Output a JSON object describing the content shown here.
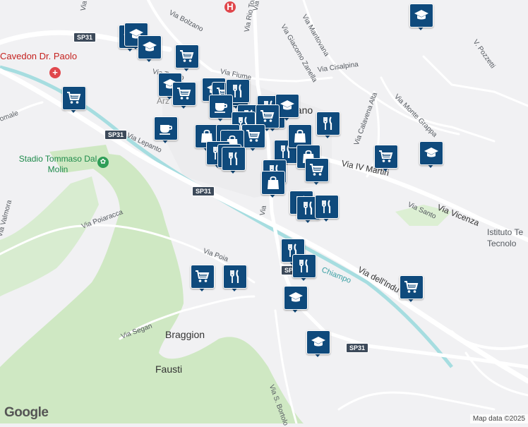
{
  "labels": {
    "streets": [
      "Via Bolzano",
      "Via Rio Torto",
      "Via Giacomo Zanella",
      "Via Mantovana",
      "Via Fiume",
      "Via Cisalpina",
      "V. Pozzetti",
      "Via Monte Grappa",
      "Via Calavena Alta",
      "Via Lepanto",
      "Via IV Martiri",
      "Via Vicenza",
      "Via Santo",
      "Via Poiaracca",
      "Via Valmora",
      "Via Poia",
      "Via dell'Indu",
      "Via Segan",
      "Via S. Bortolo",
      "Via Trento",
      "Via Mel",
      "Via T",
      "Via",
      "omale"
    ],
    "places": [
      "Braggion",
      "Fausti"
    ],
    "pois": [
      "Cavedon Dr. Paolo",
      "Stadio Tommaso Dal Molin",
      "Istituto Te",
      "Tecnolo"
    ],
    "town": [
      "Arz",
      "nano"
    ],
    "water": "Chiampo",
    "roads": [
      "SP31",
      "SP31",
      "SP31",
      "SP31",
      "SP"
    ]
  },
  "footer": {
    "logo": "Google",
    "credit": "Map data ©2025"
  },
  "colors": {
    "marker": "#0f4a7c",
    "park": "#cfe8c3",
    "water": "#a6dde0",
    "road": "#ffffff"
  },
  "markers": [
    {
      "type": "school-icon"
    },
    {
      "type": "school-icon"
    },
    {
      "type": "school-icon"
    },
    {
      "type": "school-icon"
    },
    {
      "type": "cart-icon"
    },
    {
      "type": "cart-icon"
    },
    {
      "type": "school-icon"
    },
    {
      "type": "cart-icon"
    },
    {
      "type": "school-icon"
    },
    {
      "type": "cart-icon"
    },
    {
      "type": "school-icon"
    },
    {
      "type": "cutlery-icon"
    },
    {
      "type": "coffee-icon"
    },
    {
      "type": "cutlery-icon"
    },
    {
      "type": "cart-icon"
    },
    {
      "type": "school-icon"
    },
    {
      "type": "cutlery-icon"
    },
    {
      "type": "cutlery-icon"
    },
    {
      "type": "cart-icon"
    },
    {
      "type": "cutlery-icon"
    },
    {
      "type": "coffee-icon"
    },
    {
      "type": "bag-icon"
    },
    {
      "type": "bag-icon"
    },
    {
      "type": "cart-icon"
    },
    {
      "type": "bag-icon"
    },
    {
      "type": "cutlery-icon"
    },
    {
      "type": "cutlery-icon"
    },
    {
      "type": "cutlery-icon"
    },
    {
      "type": "bag-icon"
    },
    {
      "type": "cutlery-icon"
    },
    {
      "type": "bag-icon"
    },
    {
      "type": "cart-icon"
    },
    {
      "type": "cutlery-icon"
    },
    {
      "type": "bag-icon"
    },
    {
      "type": "cart-icon"
    },
    {
      "type": "school-icon"
    },
    {
      "type": "cutlery-icon"
    },
    {
      "type": "cutlery-icon"
    },
    {
      "type": "cutlery-icon"
    },
    {
      "type": "cutlery-icon"
    },
    {
      "type": "cart-icon"
    },
    {
      "type": "cutlery-icon"
    },
    {
      "type": "cutlery-icon"
    },
    {
      "type": "cart-icon"
    },
    {
      "type": "school-icon"
    },
    {
      "type": "school-icon"
    }
  ]
}
